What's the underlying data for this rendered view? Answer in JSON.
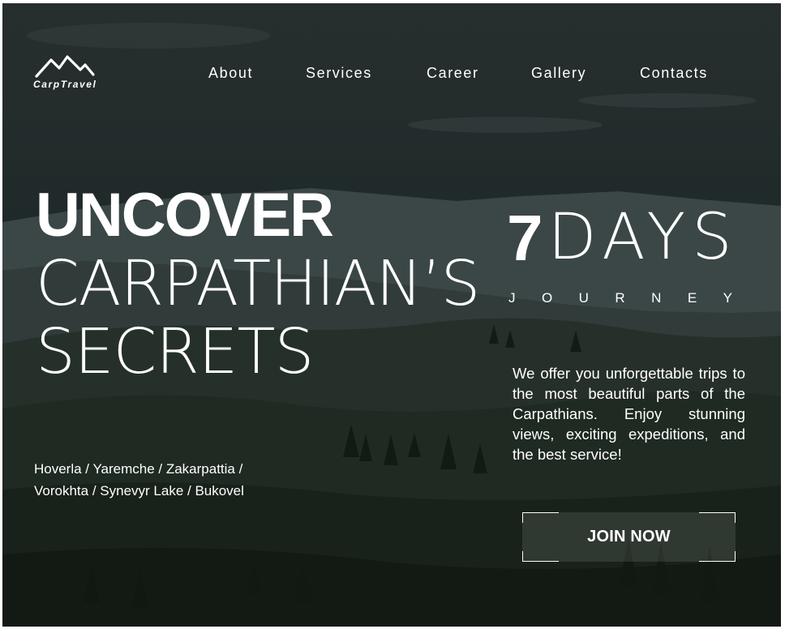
{
  "brand": {
    "logo_text": "CarpTravel",
    "logo_icon": "mountain-icon"
  },
  "nav": {
    "items": [
      {
        "label": "About"
      },
      {
        "label": "Services"
      },
      {
        "label": "Career"
      },
      {
        "label": "Gallery"
      },
      {
        "label": "Contacts"
      }
    ]
  },
  "hero": {
    "title_bold": "UNCOVER",
    "title_line2": "CARPATHIAN’S",
    "title_line3": "SECRETS",
    "days_number": "7",
    "days_word": "DAYS",
    "journey_letters": [
      "J",
      "O",
      "U",
      "R",
      "N",
      "E",
      "Y"
    ],
    "places_line1": "Hoverla / Yaremche / Zakarpattia /",
    "places_line2": "Vorokhta / Synevyr Lake / Bukovel",
    "description": "We offer you unforgettable trips to the most beautiful parts of the Carpathians. Enjoy stunning views, exciting expeditions, and the best service!",
    "cta_label": "JOIN NOW"
  },
  "colors": {
    "text": "#ffffff",
    "overlay": "#1e2826"
  }
}
